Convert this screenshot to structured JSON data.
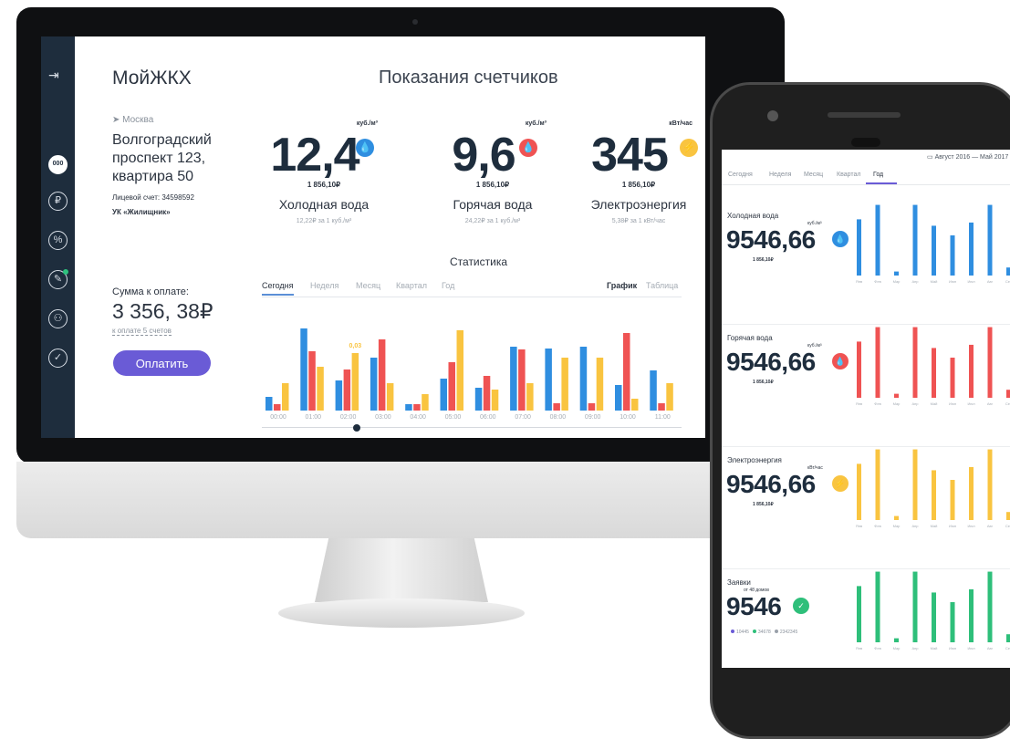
{
  "desktop": {
    "sidebar": {
      "icons": [
        {
          "name": "runner-exit-icon",
          "glyph": "⇥"
        },
        {
          "name": "meter-icon",
          "glyph": "000"
        },
        {
          "name": "ruble-icon",
          "glyph": "₽"
        },
        {
          "name": "percent-icon",
          "glyph": "%"
        },
        {
          "name": "wrench-icon",
          "glyph": "✎"
        },
        {
          "name": "persons-icon",
          "glyph": "⚇"
        },
        {
          "name": "check-icon",
          "glyph": "✓"
        }
      ]
    },
    "app_title": "МойЖКХ",
    "page_title": "Показания счетчиков",
    "location": {
      "city": "Москва",
      "address": "Волгоградский проспект 123, квартира 50",
      "account": "Лицевой счет: 34598592",
      "company": "УК «Жилищник»"
    },
    "payment": {
      "label": "Сумма к оплате:",
      "amount": "3 356, 38₽",
      "sub": "к оплате 5 счетов",
      "button": "Оплатить"
    },
    "meters": [
      {
        "unit": "куб./м³",
        "value": "12,4",
        "cost": "1 856,10₽",
        "name": "Холодная вода",
        "rate": "12,22₽ за 1 куб./м³",
        "color": "#2f8ee0",
        "icon": "💧"
      },
      {
        "unit": "куб./м³",
        "value": "9,6",
        "cost": "1 856,10₽",
        "name": "Горячая вода",
        "rate": "24,22₽ за 1 куб./м³",
        "color": "#ef5353",
        "icon": "💧"
      },
      {
        "unit": "кВт/час",
        "value": "345",
        "cost": "1 856,10₽",
        "name": "Электроэнергия",
        "rate": "5,38₽ за 1 кВт/час",
        "color": "#f9c440",
        "icon": "⚡"
      }
    ],
    "stats": {
      "title": "Статистика",
      "tabs": [
        "Сегодня",
        "Неделя",
        "Месяц",
        "Квартал",
        "Год"
      ],
      "active_tab": "Сегодня",
      "views": [
        "График",
        "Таблица"
      ],
      "active_view": "График"
    }
  },
  "mobile": {
    "period": "Август 2016 — Май 2017",
    "tabs": [
      "Сегодня",
      "Неделя",
      "Месяц",
      "Квартал",
      "Год"
    ],
    "active_tab": "Год",
    "sections": [
      {
        "label": "Холодная вода",
        "unit": "куб./м³",
        "value": "9546,66",
        "cost": "1 856,10₽",
        "color": "#2f8ee0",
        "icon": "💧"
      },
      {
        "label": "Горячая вода",
        "unit": "куб./м³",
        "value": "9546,66",
        "cost": "1 856,10₽",
        "color": "#ef5353",
        "icon": "💧"
      },
      {
        "label": "Электроэнергия",
        "unit": "кВт/час",
        "value": "9546,66",
        "cost": "1 856,10₽",
        "color": "#f9c440",
        "icon": "⚡"
      },
      {
        "label": "Заявки",
        "unit": "от 48 домов",
        "value": "9546",
        "cost": "",
        "color": "#2ebf7a",
        "icon": "✓",
        "legend": [
          {
            "value": "10445",
            "color": "#6a5bd6"
          },
          {
            "value": "34678",
            "color": "#2ebf7a"
          },
          {
            "value": "2342345",
            "color": "#9aa1aa"
          }
        ]
      }
    ]
  },
  "chart_data": [
    {
      "type": "bar",
      "categories": [
        "00:00",
        "01:00",
        "02:00",
        "03:00",
        "04:00",
        "05:00",
        "06:00",
        "07:00",
        "08:00",
        "09:00",
        "10:00",
        "11:00"
      ],
      "series": [
        {
          "values": [
            0.015,
            0.09,
            0.033,
            0.058,
            0.007,
            0.035,
            0.025,
            0.07,
            0.068,
            0.07,
            0.028,
            0.044
          ]
        },
        {
          "values": [
            0.007,
            0.065,
            0.045,
            0.078,
            0.007,
            0.053,
            0.038,
            0.067,
            0.008,
            0.008,
            0.085,
            0.008
          ]
        },
        {
          "values": [
            0.03,
            0.048,
            0.063,
            0.03,
            0.018,
            0.088,
            0.023,
            0.03,
            0.058,
            0.058,
            0.013,
            0.03
          ]
        }
      ],
      "annotation": {
        "category": "02:00",
        "label": "0,03"
      },
      "colors": [
        "#2f8ee0",
        "#ef5353",
        "#f9c440"
      ],
      "ylim": [
        0,
        0.1
      ]
    },
    {
      "type": "bar",
      "categories": [
        "Янв",
        "Фев",
        "Мар",
        "Апр",
        "Май",
        "Июн",
        "Июл",
        "Авг",
        "Сен"
      ],
      "values": [
        70,
        88,
        5,
        88,
        62,
        50,
        66,
        88,
        10
      ],
      "ylim": [
        0,
        100
      ]
    }
  ]
}
